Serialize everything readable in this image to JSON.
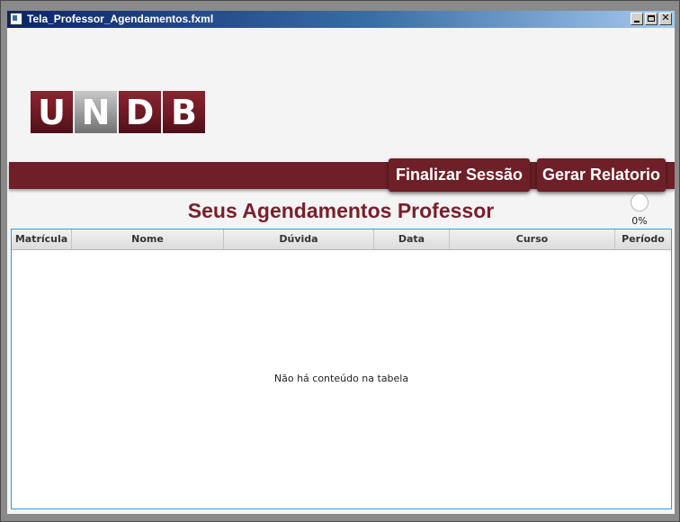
{
  "window": {
    "title": "Tela_Professor_Agendamentos.fxml",
    "minimize_glyph": "",
    "maximize_glyph": "",
    "close_glyph": "✕"
  },
  "logo": {
    "letters": [
      "U",
      "N",
      "D",
      "B"
    ]
  },
  "buttons": {
    "finalizar": "Finalizar Sessão",
    "relatorio": "Gerar Relatorio"
  },
  "page_title": "Seus Agendamentos Professor",
  "progress": {
    "label": "0%",
    "value": 0
  },
  "table": {
    "columns": [
      "Matrícula",
      "Nome",
      "Dúvida",
      "Data",
      "Curso",
      "Período"
    ],
    "rows": [],
    "empty_message": "Não há conteúdo na tabela"
  },
  "colors": {
    "brand": "#6f1f27",
    "title_text": "#7a1f2a",
    "table_border": "#2ea0d8"
  }
}
